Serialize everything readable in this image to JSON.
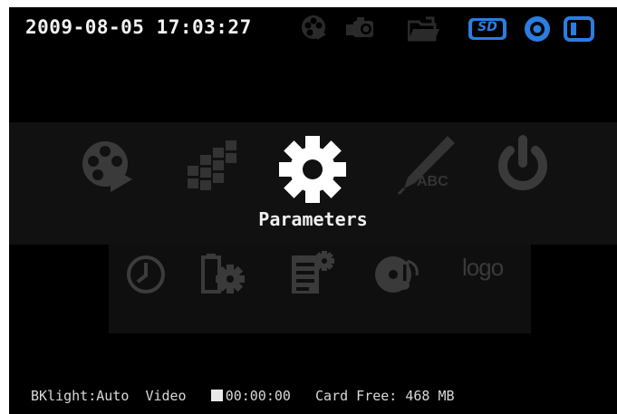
{
  "topbar": {
    "datetime": "2009-08-05 17:03:27",
    "status_icons": [
      "film-reel-icon",
      "camera-icon",
      "folder-icon",
      "sd-card-icon",
      "record-icon",
      "battery-icon"
    ],
    "sd_label": "SD"
  },
  "main_menu": {
    "items": [
      "video-playback-icon",
      "mosaic-icon",
      "gear-icon",
      "pen-abc-icon",
      "power-icon"
    ],
    "selected_label": "Parameters"
  },
  "sub_menu": {
    "items": [
      "clock-icon",
      "document-settings-icon",
      "list-settings-icon",
      "audio-disc-icon",
      "logo-icon"
    ],
    "logo_text": "logo"
  },
  "pen_text": "ABC",
  "status": {
    "backlight": "BKlight:Auto",
    "mode": "Video",
    "timer": "00:00:00",
    "card_free": "Card Free: 468 MB"
  },
  "colors": {
    "screen_bg": "#000000",
    "accent_blue": "#2b7de0",
    "inactive_gray": "#2e2e2e",
    "selected_white": "#ffffff"
  }
}
